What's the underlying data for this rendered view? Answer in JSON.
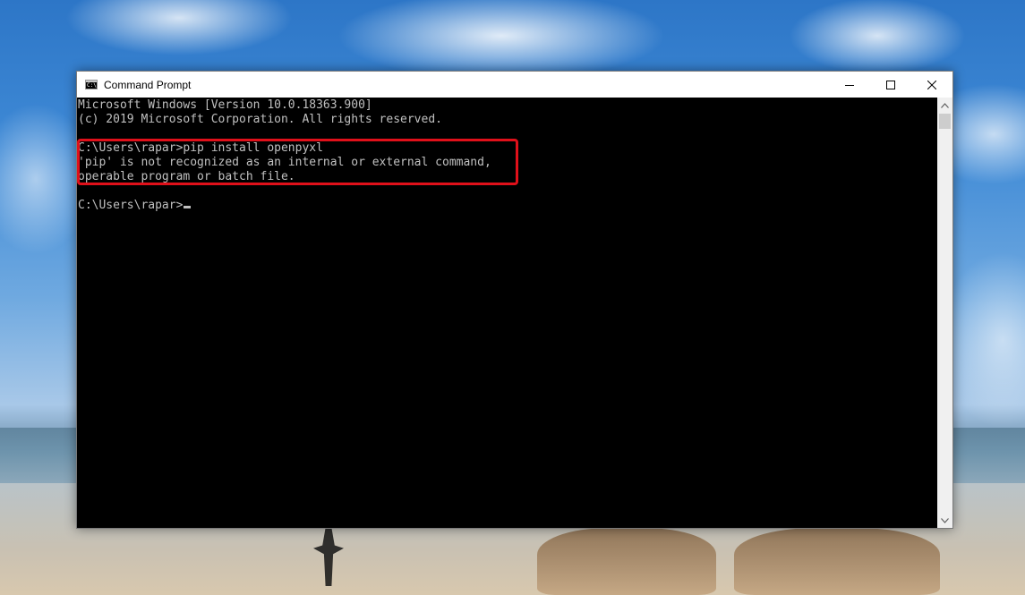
{
  "window": {
    "title": "Command Prompt",
    "app_icon_text": "C:\\",
    "controls": [
      "minimize",
      "maximize",
      "close"
    ]
  },
  "console": {
    "lines": [
      "Microsoft Windows [Version 10.0.18363.900]",
      "(c) 2019 Microsoft Corporation. All rights reserved.",
      "",
      "C:\\Users\\rapar>pip install openpyxl",
      "'pip' is not recognized as an internal or external command,",
      "operable program or batch file.",
      "",
      "C:\\Users\\rapar>"
    ],
    "text_color": "#c0c0c0",
    "background": "#000000"
  },
  "highlight": {
    "color": "#e0101a"
  }
}
